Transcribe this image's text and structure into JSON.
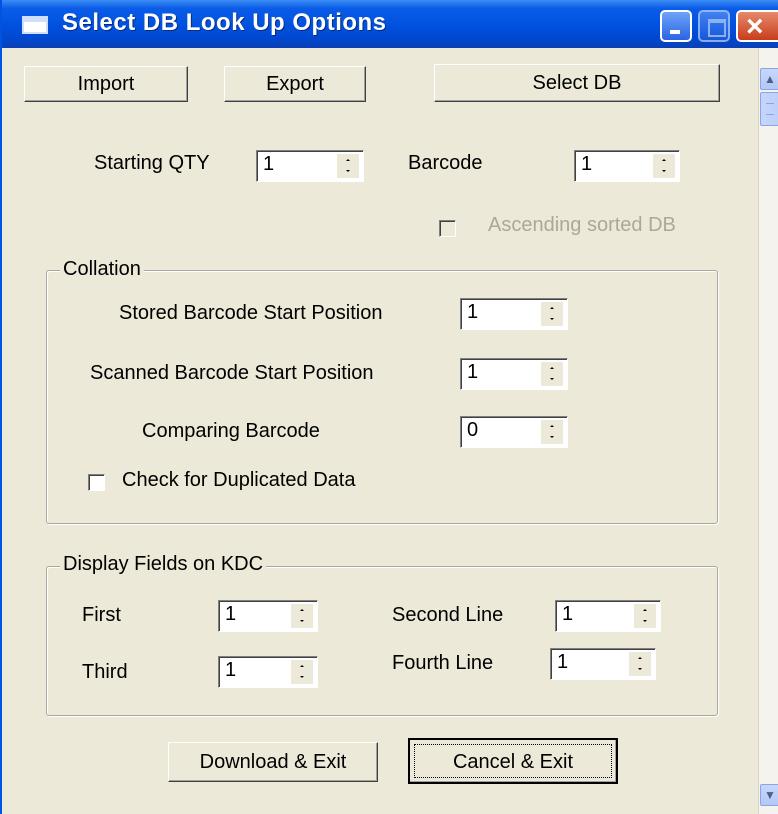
{
  "window": {
    "title": "Select DB Look Up Options"
  },
  "toolbar": {
    "import_label": "Import",
    "export_label": "Export",
    "select_db_label": "Select DB"
  },
  "top_fields": {
    "starting_qty_label": "Starting QTY",
    "starting_qty_value": "1",
    "barcode_label": "Barcode",
    "barcode_value": "1",
    "ascending_label": "Ascending sorted DB",
    "ascending_checked": false,
    "ascending_enabled": false
  },
  "collation": {
    "title": "Collation",
    "stored_label": "Stored Barcode Start Position",
    "stored_value": "1",
    "scanned_label": "Scanned Barcode Start Position",
    "scanned_value": "1",
    "comparing_label": "Comparing Barcode",
    "comparing_value": "0",
    "duplicate_label": "Check for Duplicated Data",
    "duplicate_checked": false
  },
  "display_fields": {
    "title": "Display Fields on KDC",
    "first_label": "First",
    "first_value": "1",
    "second_label": "Second Line",
    "second_value": "1",
    "third_label": "Third",
    "third_value": "1",
    "fourth_label": "Fourth Line",
    "fourth_value": "1"
  },
  "footer": {
    "download_label": "Download & Exit",
    "cancel_label": "Cancel & Exit"
  },
  "colors": {
    "titlebar": "#0052e0",
    "face": "#ece9d8",
    "disabled_text": "#aca899"
  }
}
